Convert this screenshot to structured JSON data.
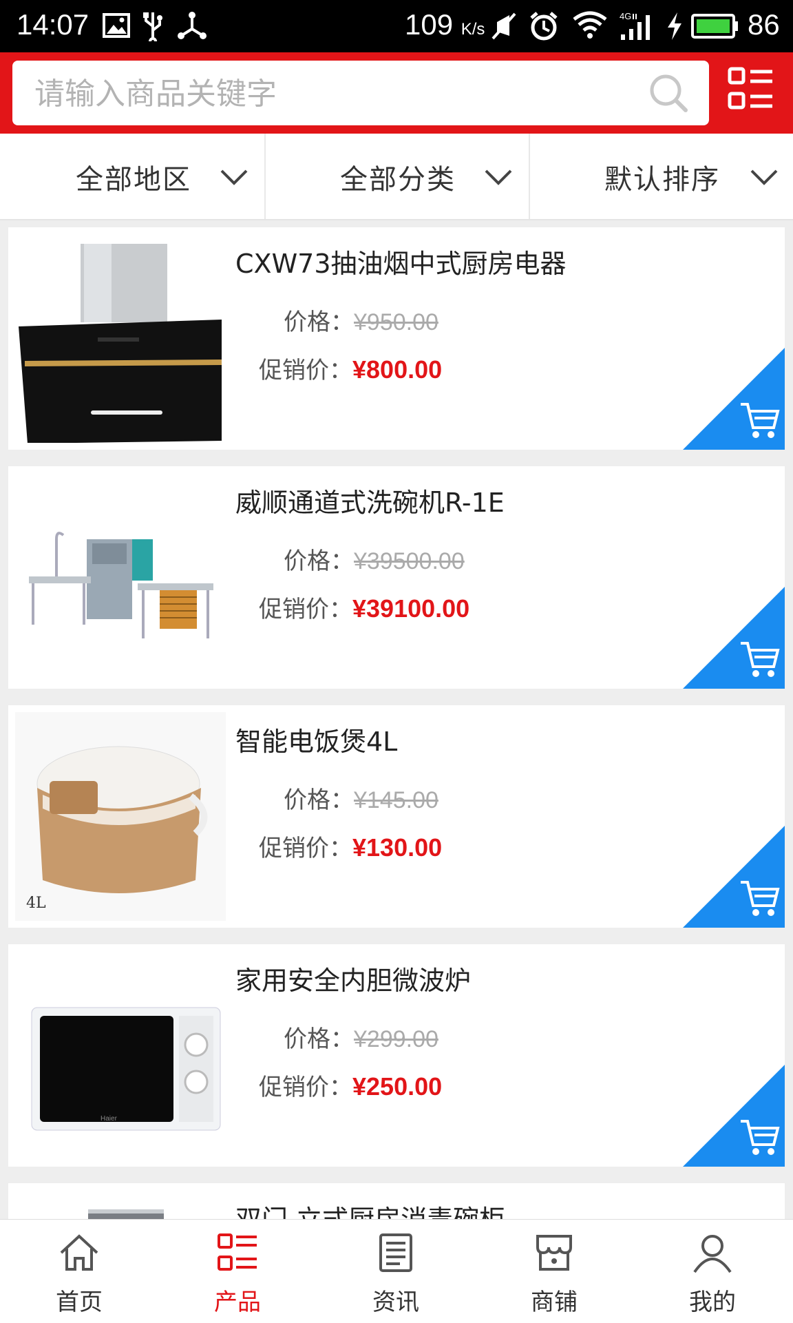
{
  "status_bar": {
    "time": "14:07",
    "speed_value": "109",
    "speed_unit": "K/s",
    "battery": "86",
    "icons": [
      "image-icon",
      "usb-icon",
      "share-icon",
      "mute-icon",
      "alarm-icon",
      "wifi-icon",
      "4g-signal-icon",
      "charging-icon",
      "battery-icon"
    ]
  },
  "search": {
    "placeholder": "请输入商品关键字"
  },
  "colors": {
    "brand": "#e21518",
    "accent": "#1a8cf0",
    "price": "#e21518"
  },
  "filters": [
    {
      "label": "全部地区"
    },
    {
      "label": "全部分类"
    },
    {
      "label": "默认排序"
    }
  ],
  "labels": {
    "price": "价格：",
    "promo": "促销价："
  },
  "products": [
    {
      "name": "CXW73抽油烟中式厨房电器",
      "price": "¥950.00",
      "promo": "¥800.00",
      "icon": "range-hood"
    },
    {
      "name": "威顺通道式洗碗机R-1E",
      "price": "¥39500.00",
      "promo": "¥39100.00",
      "icon": "dishwasher"
    },
    {
      "name": "智能电饭煲4L",
      "price": "¥145.00",
      "promo": "¥130.00",
      "icon": "rice-cooker",
      "thumb_text": "4L"
    },
    {
      "name": "家用安全内胆微波炉",
      "price": "¥299.00",
      "promo": "¥250.00",
      "icon": "microwave",
      "thumb_text": "Haier"
    },
    {
      "name": "双门 立式厨房消毒碗柜",
      "icon": "disinfection-cabinet"
    }
  ],
  "tabs": [
    {
      "label": "首页",
      "icon": "home-icon"
    },
    {
      "label": "产品",
      "icon": "grid-list-icon",
      "active": true
    },
    {
      "label": "资讯",
      "icon": "news-icon"
    },
    {
      "label": "商铺",
      "icon": "shop-icon"
    },
    {
      "label": "我的",
      "icon": "user-icon"
    }
  ]
}
